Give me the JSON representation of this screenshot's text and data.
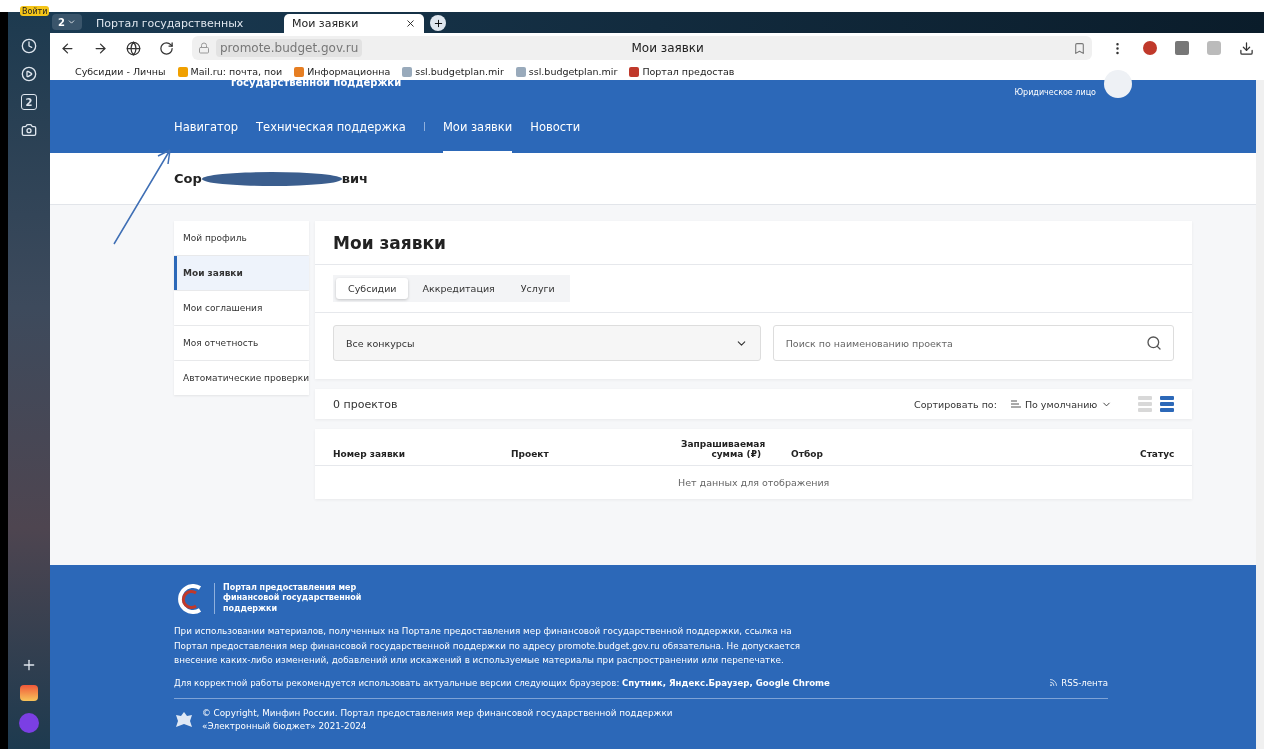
{
  "browser": {
    "profile_button": "Войти",
    "tab_count": "2",
    "tabs": [
      {
        "title": "Портал государственных",
        "selected": false
      },
      {
        "title": "Мои заявки",
        "selected": true
      }
    ],
    "address": "promote.budget.gov.ru",
    "page_title": "Мои заявки",
    "bookmarks": [
      {
        "label": "Субсидии - Личны"
      },
      {
        "label": "Mail.ru: почта, пои"
      },
      {
        "label": "Информационна"
      },
      {
        "label": "ssl.budgetplan.mir"
      },
      {
        "label": "ssl.budgetplan.mir"
      },
      {
        "label": "Портал предостав"
      }
    ],
    "side_badge": "2"
  },
  "header": {
    "logo_text": "государственной поддержки",
    "user_type": "Юридическое лицо",
    "nav": [
      {
        "label": "Навигатор",
        "selected": false
      },
      {
        "label": "Техническая поддержка",
        "selected": false
      },
      {
        "label": "Мои заявки",
        "selected": true
      },
      {
        "label": "Новости",
        "selected": false
      }
    ]
  },
  "user_name": {
    "start": "Сор",
    "end": "вич"
  },
  "sidebar": {
    "items": [
      {
        "label": "Мой профиль",
        "selected": false
      },
      {
        "label": "Мои заявки",
        "selected": true
      },
      {
        "label": "Мои соглашения",
        "selected": false
      },
      {
        "label": "Моя отчетность",
        "selected": false
      },
      {
        "label": "Автоматические проверки",
        "selected": false
      }
    ]
  },
  "main": {
    "title": "Мои заявки",
    "tabs": [
      {
        "label": "Субсидии",
        "selected": true
      },
      {
        "label": "Аккредитация",
        "selected": false
      },
      {
        "label": "Услуги",
        "selected": false
      }
    ],
    "filter": {
      "value": "Все конкурсы"
    },
    "search": {
      "placeholder": "Поиск по наименованию проекта"
    },
    "count": "0 проектов",
    "sort_label": "Сортировать по:",
    "sort_value": "По умолчанию",
    "view": {
      "list_selected": false,
      "cards_selected": true
    },
    "table": {
      "columns": [
        "Номер заявки",
        "Проект",
        "Запрашиваемая сумма (₽)",
        "Отбор",
        "Статус"
      ],
      "empty": "Нет данных для отображения"
    }
  },
  "footer": {
    "logo_text": "Портал предоставления мер финансовой государственной поддержки",
    "notice": "При использовании материалов, полученных на Портале предоставления мер финансовой государственной поддержки, ссылка на Портал предоставления мер финансовой государственной поддержки по адресу promote.budget.gov.ru обязательна. Не допускается внесение каких-либо изменений, добавлений или искажений в используемые материалы при распространении или перепечатке.",
    "browsers": "Для корректной работы рекомендуется использовать актуальные версии следующих браузеров: **Спутник, Яндекс.Браузер, Google Chrome**",
    "rss": "RSS-лента",
    "copyright": "© Copyright, Минфин России. Портал предоставления мер финансовой государственной поддержки",
    "copyright_2": "«Электронный бюджет» 2021-2024"
  }
}
